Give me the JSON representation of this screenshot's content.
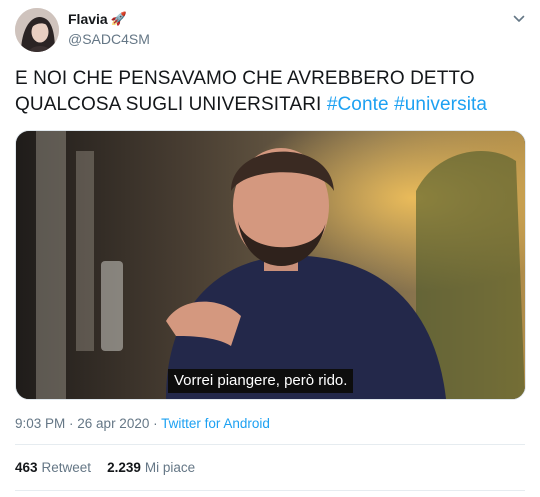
{
  "user": {
    "name": "Flavia",
    "name_emoji": "🚀",
    "handle": "@SADC4SM"
  },
  "tweet": {
    "text": "E NOI CHE PENSAVAMO CHE AVREBBERO DETTO QUALCOSA SUGLI UNIVERSITARI",
    "hashtags": [
      "#Conte",
      "#universita"
    ],
    "media_caption": "Vorrei piangere, però rido."
  },
  "meta": {
    "time": "9:03 PM",
    "separator1": " · ",
    "date": "26 apr 2020",
    "separator2": " · ",
    "client": "Twitter for Android"
  },
  "stats": {
    "retweets_count": "463",
    "retweets_label": "Retweet",
    "likes_count": "2.239",
    "likes_label": "Mi piace"
  },
  "colors": {
    "link": "#1da1f2",
    "secondary_text": "#657786",
    "primary_text": "#14171a"
  },
  "icons": {
    "menu": "chevron-down-icon",
    "emoji": "rocket"
  }
}
